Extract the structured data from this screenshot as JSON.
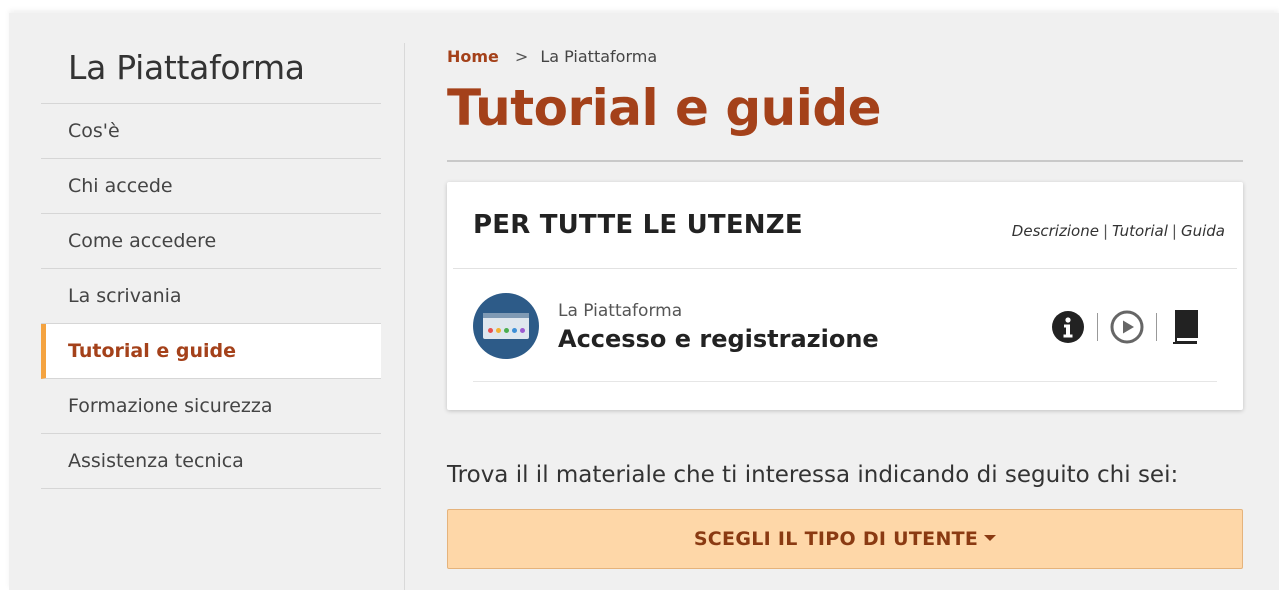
{
  "sidebar": {
    "title": "La Piattaforma",
    "items": [
      {
        "label": "Cos'è"
      },
      {
        "label": "Chi accede"
      },
      {
        "label": "Come accedere"
      },
      {
        "label": "La scrivania"
      },
      {
        "label": "Tutorial e guide",
        "active": true
      },
      {
        "label": "Formazione sicurezza"
      },
      {
        "label": "Assistenza tecnica"
      }
    ]
  },
  "breadcrumb": {
    "home": "Home",
    "separator": ">",
    "current": "La Piattaforma"
  },
  "main": {
    "title": "Tutorial e guide",
    "card": {
      "title": "PER TUTTE LE UTENZE",
      "legend": {
        "descrizione": "Descrizione",
        "tutorial": "Tutorial",
        "guida": "Guida",
        "separator": "|"
      },
      "rows": [
        {
          "category": "La Piattaforma",
          "title": "Accesso e registrazione",
          "icons": [
            "info-icon",
            "play-icon",
            "book-icon"
          ]
        }
      ]
    },
    "prompt": "Trova il il materiale che ti interessa indicando di seguito chi sei:",
    "dropdown_label": "SCEGLI IL TIPO DI UTENTE"
  },
  "colors": {
    "accent": "#a4411a",
    "active_marker": "#f4a340",
    "dropdown_bg": "#fed7a8",
    "page_bg": "#f0f0f0",
    "avatar_bg": "#2d5b88"
  }
}
